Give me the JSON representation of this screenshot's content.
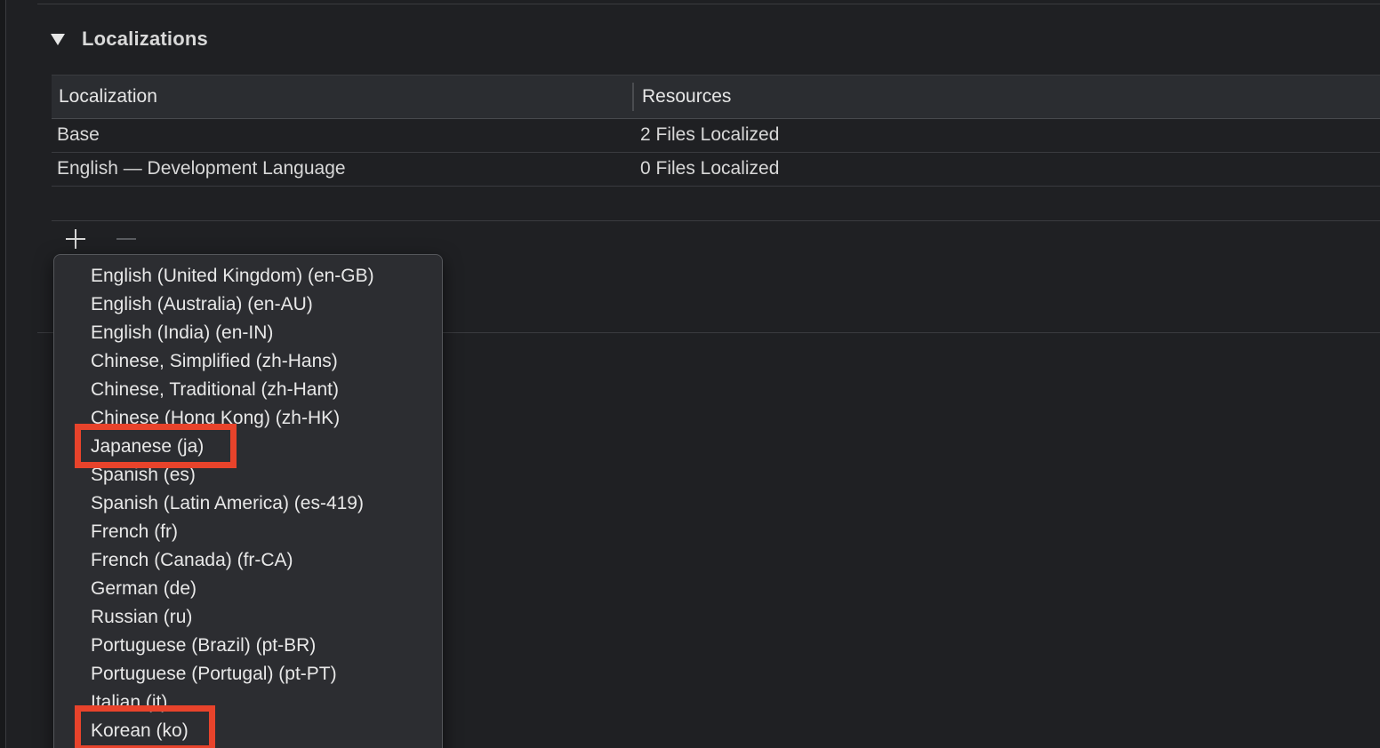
{
  "section": {
    "title": "Localizations",
    "disclosure_icon": "disclosure-triangle-down-icon"
  },
  "table": {
    "columns": [
      "Localization",
      "Resources"
    ],
    "rows": [
      {
        "localization": "Base",
        "resources": "2 Files Localized"
      },
      {
        "localization": "English — Development Language",
        "resources": "0 Files Localized"
      }
    ]
  },
  "controls": {
    "add_icon": "plus-icon",
    "remove_icon": "minus-icon"
  },
  "language_menu": {
    "items": [
      "English (United Kingdom) (en-GB)",
      "English (Australia) (en-AU)",
      "English (India) (en-IN)",
      "Chinese, Simplified (zh-Hans)",
      "Chinese, Traditional (zh-Hant)",
      "Chinese (Hong Kong) (zh-HK)",
      "Japanese (ja)",
      "Spanish (es)",
      "Spanish (Latin America) (es-419)",
      "French (fr)",
      "French (Canada) (fr-CA)",
      "German (de)",
      "Russian (ru)",
      "Portuguese (Brazil) (pt-BR)",
      "Portuguese (Portugal) (pt-PT)",
      "Italian (it)",
      "Korean (ko)"
    ],
    "highlighted": [
      "Japanese (ja)",
      "Korean (ko)"
    ]
  },
  "colors": {
    "background": "#1f2023",
    "popup_background": "#2c2d31",
    "highlight_annotation": "#e8432b",
    "text": "#e8e8e8"
  }
}
